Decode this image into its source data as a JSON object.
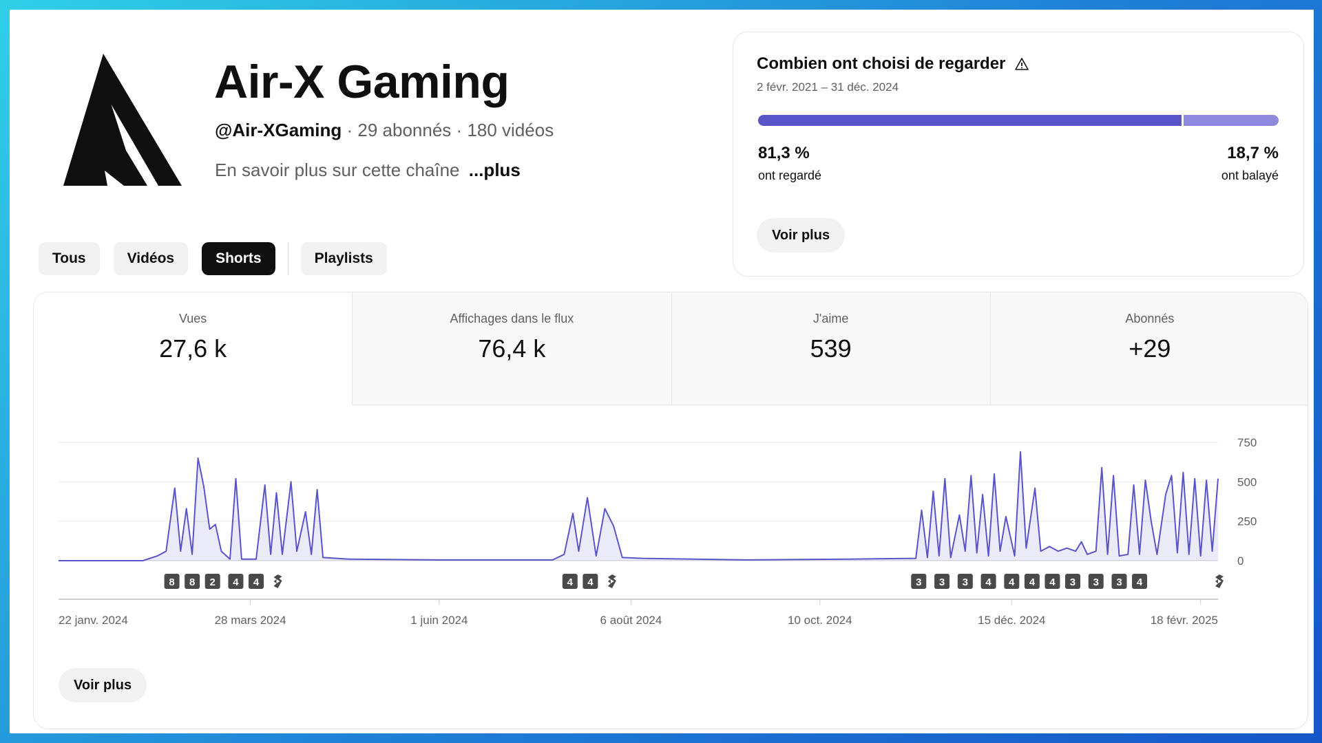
{
  "channel": {
    "name": "Air-X Gaming",
    "handle": "@Air-XGaming",
    "subscribers": "29 abonnés",
    "videos": "180 vidéos",
    "separator": "·",
    "about": "En savoir plus sur cette chaîne",
    "about_more": "...plus"
  },
  "tabs": [
    {
      "label": "Tous",
      "active": false
    },
    {
      "label": "Vidéos",
      "active": false
    },
    {
      "label": "Shorts",
      "active": true
    },
    {
      "label": "Playlists",
      "active": false
    }
  ],
  "retention_card": {
    "title": "Combien ont choisi de regarder",
    "date_range": "2 févr. 2021 – 31 déc. 2024",
    "watched_pct": "81,3 %",
    "watched_label": "ont regardé",
    "watched_fraction": 0.813,
    "swiped_pct": "18,7 %",
    "swiped_label": "ont balayé",
    "button": "Voir plus",
    "colors": {
      "watched": "#5a54c9",
      "swiped": "#8f8ae0"
    }
  },
  "metrics": [
    {
      "label": "Vues",
      "value": "27,6 k",
      "selected": true
    },
    {
      "label": "Affichages dans le flux",
      "value": "76,4 k",
      "selected": false
    },
    {
      "label": "J'aime",
      "value": "539",
      "selected": false
    },
    {
      "label": "Abonnés",
      "value": "+29",
      "selected": false
    }
  ],
  "chart_data": {
    "type": "area",
    "series_color": "#5a54c9",
    "ylim": [
      0,
      750
    ],
    "yticks": [
      "750",
      "500",
      "250",
      "0"
    ],
    "ytick_values": [
      750,
      500,
      250,
      0
    ],
    "xticks": [
      "22 janv. 2024",
      "28 mars 2024",
      "1 juin 2024",
      "6 août 2024",
      "10 oct. 2024",
      "15 déc. 2024",
      "18 févr. 2025"
    ],
    "x_start": "2024-01-22",
    "x_end": "2025-02-24",
    "points": [
      [
        "2024-01-22",
        0
      ],
      [
        "2024-02-20",
        0
      ],
      [
        "2024-02-25",
        30
      ],
      [
        "2024-02-28",
        60
      ],
      [
        "2024-03-02",
        460
      ],
      [
        "2024-03-04",
        60
      ],
      [
        "2024-03-06",
        330
      ],
      [
        "2024-03-08",
        40
      ],
      [
        "2024-03-10",
        650
      ],
      [
        "2024-03-12",
        470
      ],
      [
        "2024-03-14",
        200
      ],
      [
        "2024-03-16",
        230
      ],
      [
        "2024-03-18",
        60
      ],
      [
        "2024-03-21",
        10
      ],
      [
        "2024-03-23",
        520
      ],
      [
        "2024-03-25",
        10
      ],
      [
        "2024-03-30",
        10
      ],
      [
        "2024-04-02",
        480
      ],
      [
        "2024-04-04",
        40
      ],
      [
        "2024-04-06",
        430
      ],
      [
        "2024-04-08",
        40
      ],
      [
        "2024-04-11",
        500
      ],
      [
        "2024-04-13",
        60
      ],
      [
        "2024-04-16",
        310
      ],
      [
        "2024-04-18",
        40
      ],
      [
        "2024-04-20",
        450
      ],
      [
        "2024-04-22",
        20
      ],
      [
        "2024-05-01",
        10
      ],
      [
        "2024-06-01",
        5
      ],
      [
        "2024-07-10",
        5
      ],
      [
        "2024-07-14",
        40
      ],
      [
        "2024-07-17",
        300
      ],
      [
        "2024-07-19",
        60
      ],
      [
        "2024-07-22",
        400
      ],
      [
        "2024-07-25",
        30
      ],
      [
        "2024-07-28",
        330
      ],
      [
        "2024-07-31",
        220
      ],
      [
        "2024-08-03",
        20
      ],
      [
        "2024-08-10",
        15
      ],
      [
        "2024-09-15",
        5
      ],
      [
        "2024-10-20",
        10
      ],
      [
        "2024-11-12",
        15
      ],
      [
        "2024-11-14",
        320
      ],
      [
        "2024-11-16",
        20
      ],
      [
        "2024-11-18",
        440
      ],
      [
        "2024-11-20",
        30
      ],
      [
        "2024-11-22",
        520
      ],
      [
        "2024-11-24",
        20
      ],
      [
        "2024-11-27",
        290
      ],
      [
        "2024-11-29",
        60
      ],
      [
        "2024-12-01",
        540
      ],
      [
        "2024-12-03",
        50
      ],
      [
        "2024-12-05",
        420
      ],
      [
        "2024-12-07",
        30
      ],
      [
        "2024-12-09",
        550
      ],
      [
        "2024-12-11",
        60
      ],
      [
        "2024-12-13",
        280
      ],
      [
        "2024-12-16",
        30
      ],
      [
        "2024-12-18",
        690
      ],
      [
        "2024-12-20",
        80
      ],
      [
        "2024-12-23",
        460
      ],
      [
        "2024-12-25",
        60
      ],
      [
        "2024-12-28",
        90
      ],
      [
        "2024-12-31",
        60
      ],
      [
        "2025-01-03",
        80
      ],
      [
        "2025-01-06",
        60
      ],
      [
        "2025-01-08",
        120
      ],
      [
        "2025-01-10",
        40
      ],
      [
        "2025-01-13",
        60
      ],
      [
        "2025-01-15",
        590
      ],
      [
        "2025-01-17",
        40
      ],
      [
        "2025-01-19",
        540
      ],
      [
        "2025-01-21",
        30
      ],
      [
        "2025-01-24",
        40
      ],
      [
        "2025-01-26",
        480
      ],
      [
        "2025-01-28",
        40
      ],
      [
        "2025-01-30",
        510
      ],
      [
        "2025-02-01",
        250
      ],
      [
        "2025-02-03",
        40
      ],
      [
        "2025-02-06",
        420
      ],
      [
        "2025-02-08",
        540
      ],
      [
        "2025-02-10",
        50
      ],
      [
        "2025-02-12",
        560
      ],
      [
        "2025-02-14",
        40
      ],
      [
        "2025-02-16",
        520
      ],
      [
        "2025-02-18",
        30
      ],
      [
        "2025-02-20",
        510
      ],
      [
        "2025-02-22",
        60
      ],
      [
        "2025-02-24",
        520
      ]
    ],
    "markers": [
      {
        "date": "2024-03-01",
        "label": "8"
      },
      {
        "date": "2024-03-08",
        "label": "8"
      },
      {
        "date": "2024-03-15",
        "label": "2"
      },
      {
        "date": "2024-03-23",
        "label": "4"
      },
      {
        "date": "2024-03-30",
        "label": "4"
      },
      {
        "date": "2024-04-06",
        "label": "shorts"
      },
      {
        "date": "2024-07-16",
        "label": "4"
      },
      {
        "date": "2024-07-23",
        "label": "4"
      },
      {
        "date": "2024-07-30",
        "label": "shorts"
      },
      {
        "date": "2024-11-13",
        "label": "3"
      },
      {
        "date": "2024-11-21",
        "label": "3"
      },
      {
        "date": "2024-11-29",
        "label": "3"
      },
      {
        "date": "2024-12-07",
        "label": "4"
      },
      {
        "date": "2024-12-15",
        "label": "4"
      },
      {
        "date": "2024-12-22",
        "label": "4"
      },
      {
        "date": "2024-12-29",
        "label": "4"
      },
      {
        "date": "2025-01-05",
        "label": "3"
      },
      {
        "date": "2025-01-13",
        "label": "3"
      },
      {
        "date": "2025-01-21",
        "label": "3"
      },
      {
        "date": "2025-01-28",
        "label": "4"
      },
      {
        "date": "2025-02-24",
        "label": "shorts"
      }
    ]
  },
  "chart_button": "Voir plus"
}
